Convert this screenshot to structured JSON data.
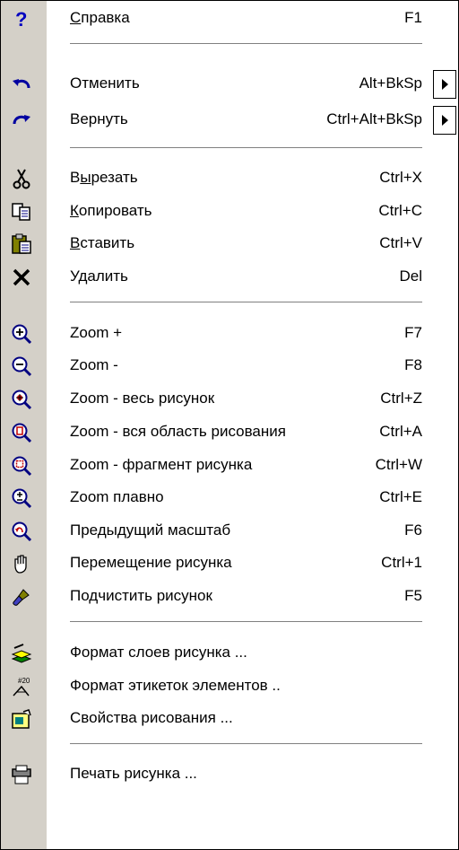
{
  "menu": {
    "items": [
      {
        "label": "Справка",
        "mnemonic": "С",
        "shortcut": "F1",
        "icon": "help-question-icon"
      },
      {
        "label": "Отменить",
        "shortcut": "Alt+BkSp",
        "icon": "undo-icon",
        "submenu": true
      },
      {
        "label": "Вернуть",
        "shortcut": "Ctrl+Alt+BkSp",
        "icon": "redo-icon",
        "submenu": true
      },
      {
        "label": "Вырезать",
        "mnemonic": "ы",
        "shortcut": "Ctrl+X",
        "icon": "scissors-icon"
      },
      {
        "label": "Копировать",
        "mnemonic": "К",
        "shortcut": "Ctrl+C",
        "icon": "copy-icon"
      },
      {
        "label": "Вставить",
        "mnemonic": "В",
        "shortcut": "Ctrl+V",
        "icon": "paste-icon"
      },
      {
        "label": "Удалить",
        "shortcut": "Del",
        "icon": "delete-x-icon"
      },
      {
        "label": "Zoom +",
        "shortcut": "F7",
        "icon": "zoom-in-icon"
      },
      {
        "label": "Zoom -",
        "shortcut": "F8",
        "icon": "zoom-out-icon"
      },
      {
        "label": "Zoom - весь рисунок",
        "shortcut": "Ctrl+Z",
        "icon": "zoom-all-icon"
      },
      {
        "label": "Zoom - вся область рисования",
        "shortcut": "Ctrl+A",
        "icon": "zoom-area-icon"
      },
      {
        "label": "Zoom - фрагмент рисунка",
        "shortcut": "Ctrl+W",
        "icon": "zoom-fragment-icon"
      },
      {
        "label": "Zoom плавно",
        "shortcut": "Ctrl+E",
        "icon": "zoom-smooth-icon"
      },
      {
        "label": "Предыдущий масштаб",
        "shortcut": "F6",
        "icon": "zoom-previous-icon"
      },
      {
        "label": "Перемещение рисунка",
        "shortcut": "Ctrl+1",
        "icon": "hand-pan-icon"
      },
      {
        "label": "Подчистить рисунок",
        "shortcut": "F5",
        "icon": "brush-clean-icon"
      },
      {
        "label": "Формат слоев рисунка ...",
        "shortcut": "",
        "icon": "layers-format-icon"
      },
      {
        "label": "Формат этикеток элементов ..",
        "shortcut": "",
        "icon": "labels-format-icon"
      },
      {
        "label": "Свойства рисования ...",
        "shortcut": "",
        "icon": "drawing-properties-icon"
      },
      {
        "label": "Печать рисунка ...",
        "shortcut": "",
        "icon": "print-icon"
      }
    ]
  }
}
